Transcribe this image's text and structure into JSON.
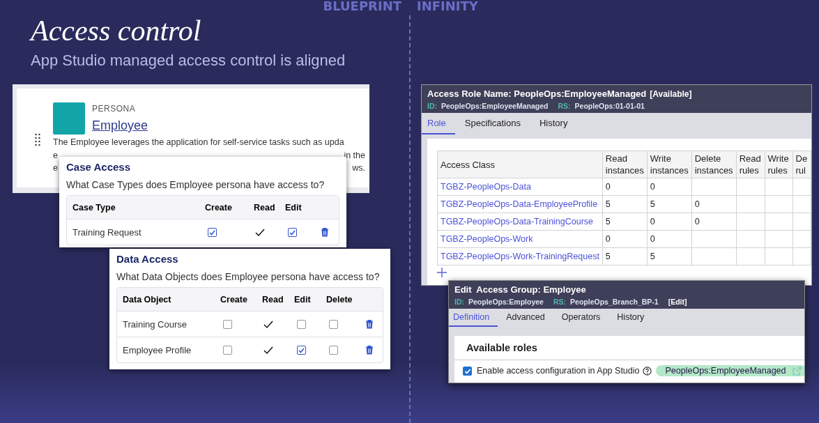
{
  "slide": {
    "brand_left": "BLUEPRINT",
    "brand_right": "INFINITY",
    "title": "Access control",
    "subtitle": "App Studio managed access control is aligned"
  },
  "persona_card": {
    "label": "PERSONA",
    "name": "Employee",
    "description": "The Employee leverages the application for self-service tasks such as upda",
    "covered_lines": [
      [
        "e",
        "in the"
      ],
      [
        "e",
        "ws."
      ]
    ]
  },
  "case_access": {
    "title": "Case Access",
    "question": "What Case Types does Employee persona have access to?",
    "columns": [
      "Case Type",
      "Create",
      "Read",
      "Edit"
    ],
    "rows": [
      {
        "name": "Training Request",
        "cells": [
          {
            "kind": "checkbox",
            "checked": true
          },
          {
            "kind": "tick"
          },
          {
            "kind": "checkbox",
            "checked": true
          }
        ]
      }
    ]
  },
  "data_access": {
    "title": "Data Access",
    "question": "What Data Objects does Employee persona have access to?",
    "columns": [
      "Data Object",
      "Create",
      "Read",
      "Edit",
      "Delete"
    ],
    "rows": [
      {
        "name": "Training Course",
        "cells": [
          {
            "kind": "checkbox",
            "checked": false
          },
          {
            "kind": "tick"
          },
          {
            "kind": "checkbox",
            "checked": false
          },
          {
            "kind": "checkbox",
            "checked": false
          }
        ]
      },
      {
        "name": "Employee Profile",
        "cells": [
          {
            "kind": "checkbox",
            "checked": false
          },
          {
            "kind": "tick"
          },
          {
            "kind": "checkbox",
            "checked": true
          },
          {
            "kind": "checkbox",
            "checked": false
          }
        ]
      }
    ]
  },
  "access_role": {
    "title": "Access Role Name: PeopleOps:EmployeeManaged",
    "status": "[Available]",
    "id_label": "ID:",
    "id": "PeopleOps:EmployeeManaged",
    "rs_label": "RS:",
    "rs": "PeopleOps:01-01-01",
    "tabs": [
      {
        "label": "Role",
        "selected": true
      },
      {
        "label": "Specifications",
        "selected": false
      },
      {
        "label": "History",
        "selected": false
      }
    ],
    "table": {
      "columns": [
        "Access Class",
        "Read instances",
        "Write instances",
        "Delete instances",
        "Read rules",
        "Write rules",
        "De rul"
      ],
      "rows": [
        {
          "access_class": "TGBZ-PeopleOps-Data",
          "read_instances": "0",
          "write_instances": "0"
        },
        {
          "access_class": "TGBZ-PeopleOps-Data-EmployeeProfile",
          "read_instances": "5",
          "write_instances": "5",
          "delete_instances": "0"
        },
        {
          "access_class": "TGBZ-PeopleOps-Data-TrainingCourse",
          "read_instances": "5",
          "write_instances": "0",
          "delete_instances": "0"
        },
        {
          "access_class": "TGBZ-PeopleOps-Work",
          "read_instances": "0",
          "write_instances": "0"
        },
        {
          "access_class": "TGBZ-PeopleOps-Work-TrainingRequest",
          "read_instances": "5",
          "write_instances": "5"
        }
      ]
    }
  },
  "access_group": {
    "title": "Edit  Access Group: Employee",
    "id_label": "ID:",
    "id": "PeopleOps:Employee",
    "rs_label": "RS:",
    "rs": "PeopleOps_Branch_BP-1",
    "edit": "[Edit]",
    "tabs": [
      {
        "label": "Definition",
        "selected": true
      },
      {
        "label": "Advanced",
        "selected": false
      },
      {
        "label": "Operators",
        "selected": false
      },
      {
        "label": "History",
        "selected": false
      }
    ],
    "section": "Available roles",
    "enable": {
      "label": "Enable access configuration in App Studio",
      "checked": true
    },
    "role": "PeopleOps:EmployeeManaged"
  }
}
